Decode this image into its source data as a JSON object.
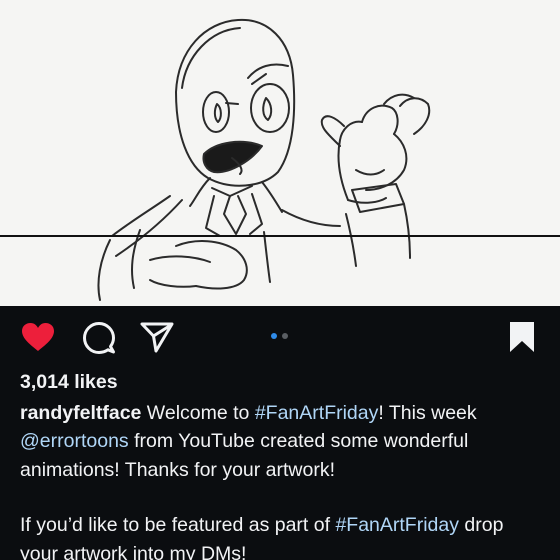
{
  "post": {
    "likes_text": "3,014 likes",
    "carousel": {
      "count": 2,
      "active_index": 0
    },
    "liked": true,
    "caption": {
      "username": "randyfeltface",
      "part1": " Welcome to ",
      "hashtag1": "#FanArtFriday",
      "part2": "! This week ",
      "mention": "@errortoons",
      "part3": " from YouTube created some wonderful animations! Thanks for your artwork!",
      "para2_part1": "If you’d like to be featured as part of ",
      "hashtag2": "#FanArtFriday",
      "para2_part2": " drop your artwork into my DMs!"
    }
  },
  "icons": {
    "like": "heart-filled-icon",
    "comment": "comment-bubble-icon",
    "share": "paper-plane-icon",
    "save": "bookmark-filled-icon"
  },
  "colors": {
    "background": "#0b0d10",
    "text": "#f2f3f5",
    "link": "#b0d6f7",
    "like_red": "#ed1f3b",
    "active_dot": "#2f8be9"
  }
}
